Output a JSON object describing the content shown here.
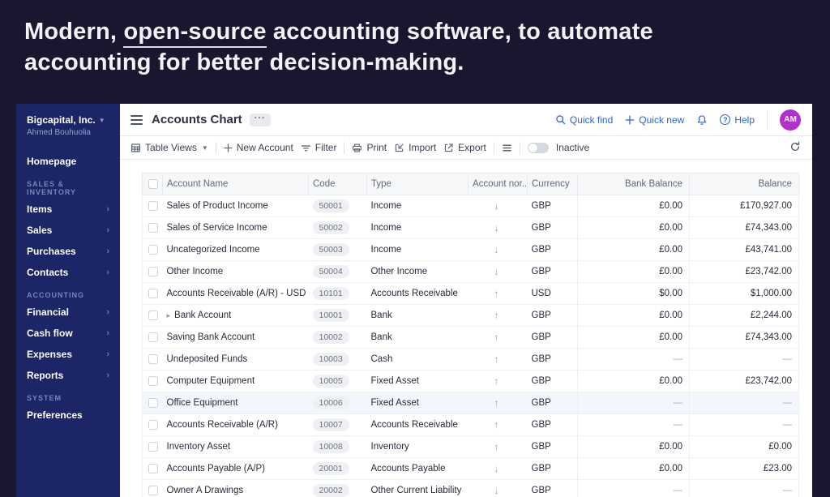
{
  "colors": {
    "page_bg": "#18172f",
    "sidebar_bg": "#1c2566",
    "accent_blue": "#2c62d9",
    "avatar_bg": "#b132c8",
    "table_header_bg": "#f6f7f9",
    "highlight_row_bg": "#f3f6fd"
  },
  "hero": {
    "line1_prefix": "Modern, ",
    "line1_underline": "open-source",
    "line1_suffix": " accounting software, to automate",
    "line2": "accounting for better decision-making."
  },
  "sidebar": {
    "org_name": "Bigcapital, Inc.",
    "user_name": "Ahmed Bouhuolia",
    "nav": [
      {
        "type": "item",
        "label": "Homepage",
        "has_submenu": false
      },
      {
        "type": "section",
        "label": "SALES & INVENTORY"
      },
      {
        "type": "item",
        "label": "Items",
        "has_submenu": true
      },
      {
        "type": "item",
        "label": "Sales",
        "has_submenu": true
      },
      {
        "type": "item",
        "label": "Purchases",
        "has_submenu": true
      },
      {
        "type": "item",
        "label": "Contacts",
        "has_submenu": true
      },
      {
        "type": "section",
        "label": "ACCOUNTING"
      },
      {
        "type": "item",
        "label": "Financial",
        "has_submenu": true
      },
      {
        "type": "item",
        "label": "Cash flow",
        "has_submenu": true
      },
      {
        "type": "item",
        "label": "Expenses",
        "has_submenu": true
      },
      {
        "type": "item",
        "label": "Reports",
        "has_submenu": true
      },
      {
        "type": "section",
        "label": "SYSTEM"
      },
      {
        "type": "item",
        "label": "Preferences",
        "has_submenu": false
      }
    ]
  },
  "header": {
    "title": "Accounts Chart",
    "more_label": "···",
    "quick_find": "Quick find",
    "quick_new": "Quick new",
    "help": "Help",
    "avatar_initials": "AM"
  },
  "toolbar": {
    "table_views": "Table Views",
    "new_account": "New Account",
    "filter": "Filter",
    "print": "Print",
    "import": "Import",
    "export": "Export",
    "inactive": "Inactive",
    "inactive_on": false
  },
  "table": {
    "columns": [
      "Account Name",
      "Code",
      "Type",
      "Account nor...",
      "Currency",
      "Bank Balance",
      "Balance"
    ],
    "rows": [
      {
        "name": "Sales of Product Income",
        "code": "50001",
        "type": "Income",
        "normal": "credit",
        "currency": "GBP",
        "bank_balance": "£0.00",
        "balance": "£170,927.00",
        "expandable": false,
        "highlighted": false
      },
      {
        "name": "Sales of Service Income",
        "code": "50002",
        "type": "Income",
        "normal": "credit",
        "currency": "GBP",
        "bank_balance": "£0.00",
        "balance": "£74,343.00",
        "expandable": false,
        "highlighted": false
      },
      {
        "name": "Uncategorized Income",
        "code": "50003",
        "type": "Income",
        "normal": "credit",
        "currency": "GBP",
        "bank_balance": "£0.00",
        "balance": "£43,741.00",
        "expandable": false,
        "highlighted": false
      },
      {
        "name": "Other Income",
        "code": "50004",
        "type": "Other Income",
        "normal": "credit",
        "currency": "GBP",
        "bank_balance": "£0.00",
        "balance": "£23,742.00",
        "expandable": false,
        "highlighted": false
      },
      {
        "name": "Accounts Receivable (A/R) - USD",
        "code": "10101",
        "type": "Accounts Receivable",
        "normal": "debit",
        "currency": "USD",
        "bank_balance": "$0.00",
        "balance": "$1,000.00",
        "expandable": false,
        "highlighted": false
      },
      {
        "name": "Bank Account",
        "code": "10001",
        "type": "Bank",
        "normal": "debit",
        "currency": "GBP",
        "bank_balance": "£0.00",
        "balance": "£2,244.00",
        "expandable": true,
        "highlighted": false
      },
      {
        "name": "Saving Bank Account",
        "code": "10002",
        "type": "Bank",
        "normal": "debit",
        "currency": "GBP",
        "bank_balance": "£0.00",
        "balance": "£74,343.00",
        "expandable": false,
        "highlighted": false
      },
      {
        "name": "Undeposited Funds",
        "code": "10003",
        "type": "Cash",
        "normal": "debit",
        "currency": "GBP",
        "bank_balance": "—",
        "balance": "—",
        "expandable": false,
        "highlighted": false
      },
      {
        "name": "Computer Equipment",
        "code": "10005",
        "type": "Fixed Asset",
        "normal": "debit",
        "currency": "GBP",
        "bank_balance": "£0.00",
        "balance": "£23,742.00",
        "expandable": false,
        "highlighted": false
      },
      {
        "name": "Office Equipment",
        "code": "10006",
        "type": "Fixed Asset",
        "normal": "debit",
        "currency": "GBP",
        "bank_balance": "—",
        "balance": "—",
        "expandable": false,
        "highlighted": true
      },
      {
        "name": "Accounts Receivable (A/R)",
        "code": "10007",
        "type": "Accounts Receivable",
        "normal": "debit",
        "currency": "GBP",
        "bank_balance": "—",
        "balance": "—",
        "expandable": false,
        "highlighted": false
      },
      {
        "name": "Inventory Asset",
        "code": "10008",
        "type": "Inventory",
        "normal": "debit",
        "currency": "GBP",
        "bank_balance": "£0.00",
        "balance": "£0.00",
        "expandable": false,
        "highlighted": false
      },
      {
        "name": "Accounts Payable (A/P)",
        "code": "20001",
        "type": "Accounts Payable",
        "normal": "credit",
        "currency": "GBP",
        "bank_balance": "£0.00",
        "balance": "£23.00",
        "expandable": false,
        "highlighted": false
      },
      {
        "name": "Owner A Drawings",
        "code": "20002",
        "type": "Other Current Liability",
        "normal": "credit",
        "currency": "GBP",
        "bank_balance": "—",
        "balance": "—",
        "expandable": false,
        "highlighted": false
      }
    ]
  }
}
